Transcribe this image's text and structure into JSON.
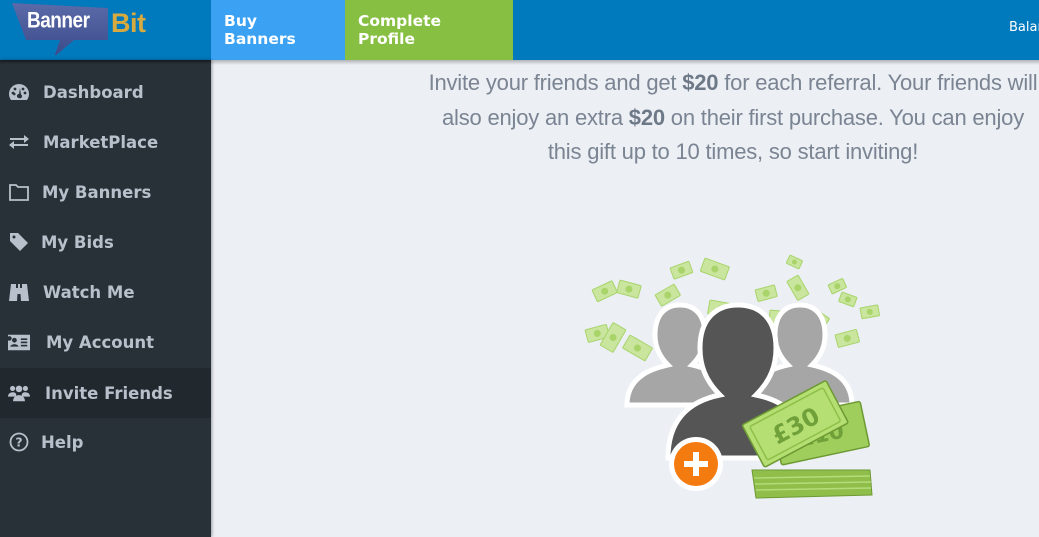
{
  "header": {
    "logo": {
      "word1": "Banner",
      "word2": "Bit"
    },
    "nav": [
      {
        "label": "Buy Banners",
        "color": "#3ba1f3"
      },
      {
        "label": "Complete Profile",
        "color": "#87bf42"
      }
    ],
    "balance_label": "Balar",
    "background": "#0179bd"
  },
  "sidebar": {
    "items": [
      {
        "label": "Dashboard",
        "icon": "dashboard-gauge-icon",
        "active": false
      },
      {
        "label": "MarketPlace",
        "icon": "exchange-arrows-icon",
        "active": false
      },
      {
        "label": "My Banners",
        "icon": "folder-icon",
        "active": false
      },
      {
        "label": "My Bids",
        "icon": "tag-icon",
        "active": false
      },
      {
        "label": "Watch Me",
        "icon": "binoculars-icon",
        "active": false
      },
      {
        "label": "My Account",
        "icon": "id-card-icon",
        "active": false
      },
      {
        "label": "Invite Friends",
        "icon": "users-icon",
        "active": true
      },
      {
        "label": "Help",
        "icon": "question-circle-icon",
        "active": false
      }
    ]
  },
  "main": {
    "intro": {
      "part1": "Invite your friends and get ",
      "bonus1": "$20",
      "part2": " for each referral. Your friends will also enjoy an extra ",
      "bonus2": "$20",
      "part3": " on their first purchase. You can enjoy this gift up to 10 times, so start inviting!"
    },
    "illustration": {
      "note_front": "£30",
      "note_back": "£10",
      "add_badge": "+",
      "accent_orange": "#f47b10",
      "money_green": "#a8d46a"
    }
  }
}
